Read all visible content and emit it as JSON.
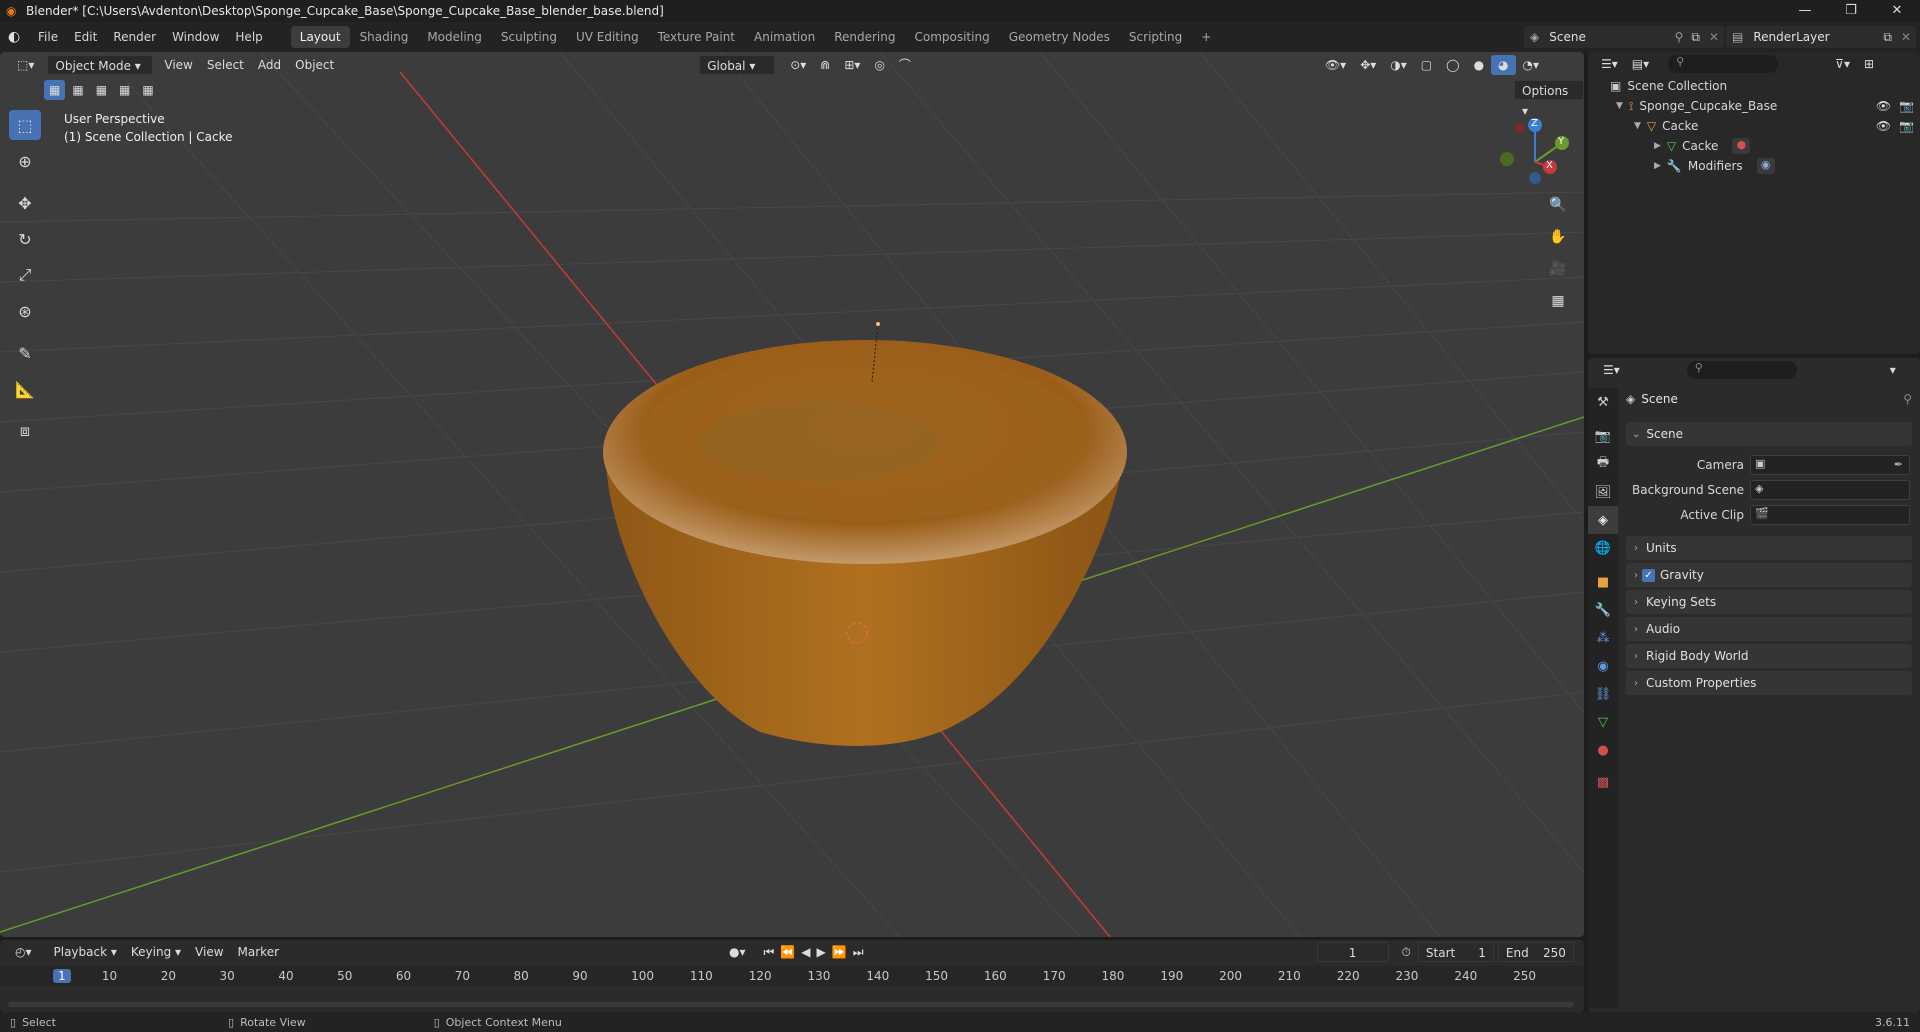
{
  "window": {
    "title": "Blender* [C:\\Users\\Avdenton\\Desktop\\Sponge_Cupcake_Base\\Sponge_Cupcake_Base_blender_base.blend]",
    "controls": [
      "—",
      "❐",
      "✕"
    ]
  },
  "menu": [
    "File",
    "Edit",
    "Render",
    "Window",
    "Help"
  ],
  "workspaces": [
    {
      "label": "Layout",
      "active": true
    },
    {
      "label": "Shading"
    },
    {
      "label": "Modeling"
    },
    {
      "label": "Sculpting"
    },
    {
      "label": "UV Editing"
    },
    {
      "label": "Texture Paint"
    },
    {
      "label": "Animation"
    },
    {
      "label": "Rendering"
    },
    {
      "label": "Compositing"
    },
    {
      "label": "Geometry Nodes"
    },
    {
      "label": "Scripting"
    }
  ],
  "add_workspace": "+",
  "scene_selector": {
    "value": "Scene"
  },
  "view_layer": {
    "value": "RenderLayer"
  },
  "viewport": {
    "mode": "Object Mode",
    "menus": [
      "View",
      "Select",
      "Add",
      "Object"
    ],
    "transform_orientation": "Global",
    "options_label": "Options",
    "info_line1": "User Perspective",
    "info_line2": "(1) Scene Collection | Cacke",
    "gizmo": {
      "z": "Z",
      "y": "Y",
      "x": "X"
    },
    "colors": {
      "x_axis": "#c43a3a",
      "y_axis": "#6a9a2a",
      "background": "#3c3c3c",
      "grid": "#474747",
      "cupcake": "#b8761e"
    }
  },
  "outliner": {
    "root": "Scene Collection",
    "items": [
      {
        "label": "Sponge_Cupcake_Base",
        "level": 1
      },
      {
        "label": "Cacke",
        "level": 2
      },
      {
        "label": "Cacke",
        "level": 3
      },
      {
        "label": "Modifiers",
        "level": 3
      }
    ]
  },
  "properties": {
    "header": "Scene",
    "section": "Scene",
    "fields": [
      {
        "label": "Camera"
      },
      {
        "label": "Background Scene"
      },
      {
        "label": "Active Clip"
      }
    ],
    "panels": [
      {
        "label": "Units"
      },
      {
        "label": "Gravity",
        "checked": true
      },
      {
        "label": "Keying Sets"
      },
      {
        "label": "Audio"
      },
      {
        "label": "Rigid Body World"
      },
      {
        "label": "Custom Properties"
      }
    ]
  },
  "timeline": {
    "menus": [
      "Playback",
      "Keying",
      "View",
      "Marker"
    ],
    "current_frame": "1",
    "start_label": "Start",
    "start_value": "1",
    "end_label": "End",
    "end_value": "250",
    "ticks": [
      "1",
      "10",
      "20",
      "30",
      "40",
      "50",
      "60",
      "70",
      "80",
      "90",
      "100",
      "110",
      "120",
      "130",
      "140",
      "150",
      "160",
      "170",
      "180",
      "190",
      "200",
      "210",
      "220",
      "230",
      "240",
      "250"
    ]
  },
  "status": {
    "left": "Select",
    "middle": "Rotate View",
    "right": "Object Context Menu",
    "version": "3.6.11"
  }
}
